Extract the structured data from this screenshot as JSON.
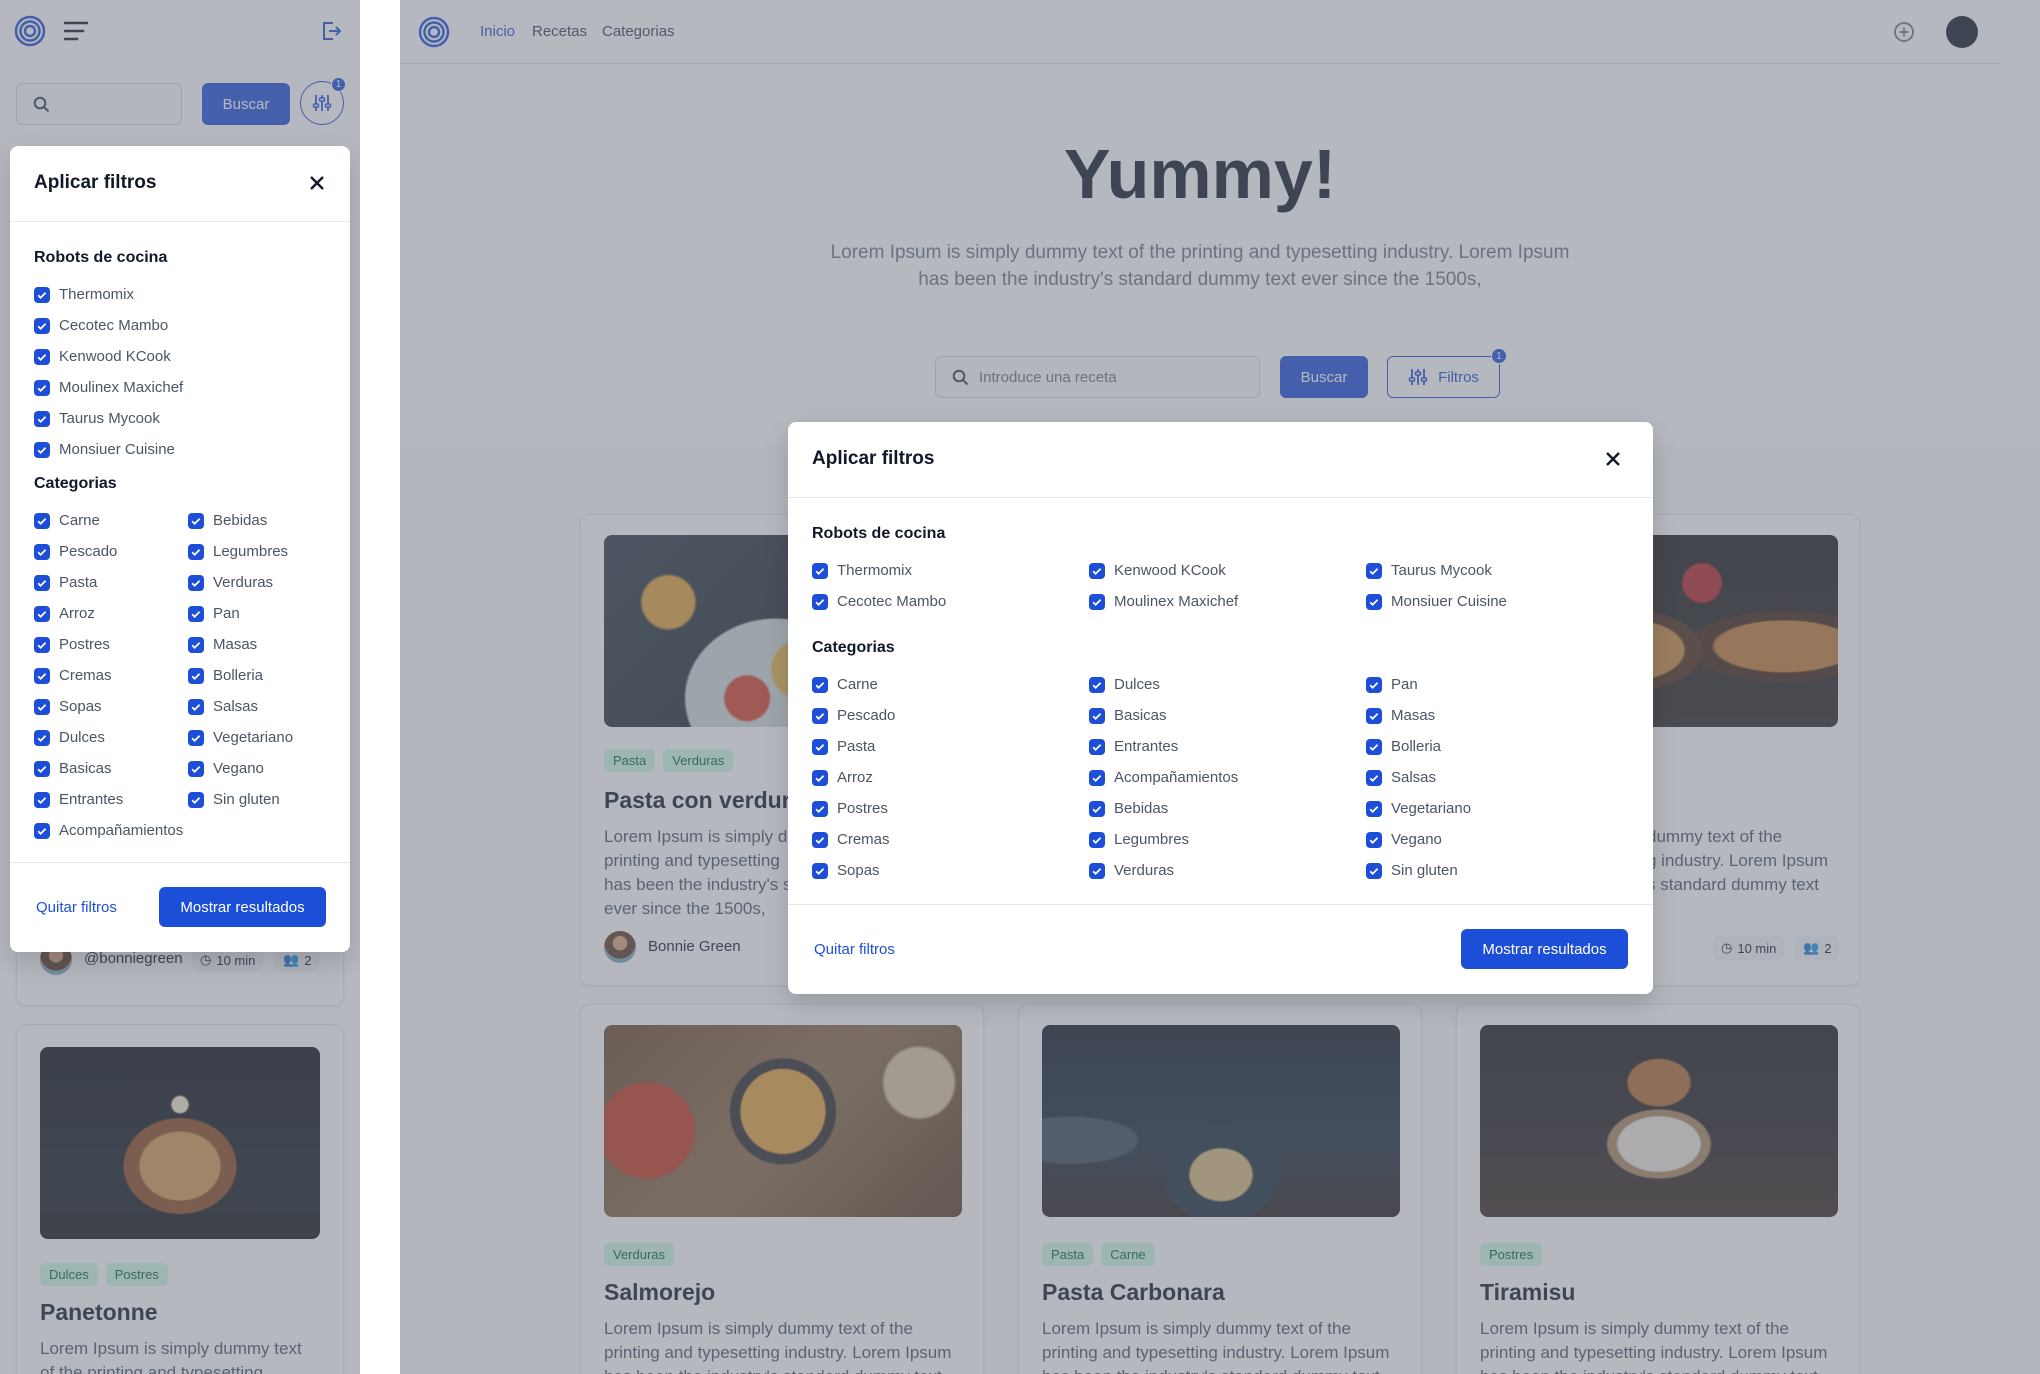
{
  "topnav": {
    "links": [
      "Inicio",
      "Recetas",
      "Categorias"
    ]
  },
  "hero": {
    "title": "Yummy!",
    "subtitle_line1": "Lorem Ipsum is simply dummy text of the printing and typesetting industry. Lorem Ipsum",
    "subtitle_line2": "has been the industry's standard dummy text ever since the 1500s,",
    "search_placeholder": "Introduce una receta",
    "search_button": "Buscar",
    "filters_button": "Filtros",
    "filters_badge": "1"
  },
  "sidebar": {
    "search_button": "Buscar",
    "filters_badge": "1"
  },
  "side_filter_panel": {
    "title": "Aplicar filtros",
    "robots_title": "Robots de cocina",
    "robots": [
      "Thermomix",
      "Cecotec Mambo",
      "Kenwood KCook",
      "Moulinex Maxichef",
      "Taurus Mycook",
      "Monsiuer Cuisine"
    ],
    "categories_title": "Categorias",
    "categories_col1": [
      "Carne",
      "Pescado",
      "Pasta",
      "Arroz",
      "Postres",
      "Cremas",
      "Sopas",
      "Dulces",
      "Basicas",
      "Entrantes",
      "Acompañamientos"
    ],
    "categories_col2": [
      "Bebidas",
      "Legumbres",
      "Verduras",
      "Pan",
      "Masas",
      "Bolleria",
      "Salsas",
      "Vegetariano",
      "Vegano",
      "Sin gluten"
    ],
    "clear_label": "Quitar filtros",
    "show_label": "Mostrar resultados"
  },
  "modal_filter_panel": {
    "title": "Aplicar filtros",
    "robots_title": "Robots de cocina",
    "robots_col1": [
      "Thermomix",
      "Cecotec Mambo"
    ],
    "robots_col2": [
      "Kenwood KCook",
      "Moulinex Maxichef"
    ],
    "robots_col3": [
      "Taurus Mycook",
      "Monsiuer Cuisine"
    ],
    "categories_title": "Categorias",
    "categories_col1": [
      "Carne",
      "Pescado",
      "Pasta",
      "Arroz",
      "Postres",
      "Cremas",
      "Sopas"
    ],
    "categories_col2": [
      "Dulces",
      "Basicas",
      "Entrantes",
      "Acompañamientos",
      "Bebidas",
      "Legumbres",
      "Verduras"
    ],
    "categories_col3": [
      "Pan",
      "Masas",
      "Bolleria",
      "Salsas",
      "Vegetariano",
      "Vegano",
      "Sin gluten"
    ],
    "clear_label": "Quitar filtros",
    "show_label": "Mostrar resultados"
  },
  "sidebar_card_top": {
    "author": "@bonniegreen",
    "time": "10 min",
    "servings": "2"
  },
  "sidebar_card": {
    "tags": [
      "Dulces",
      "Postres"
    ],
    "title": "Panetonne",
    "desc_line1": "Lorem Ipsum is simply dummy text",
    "desc_line2": "of the printing and typesetting"
  },
  "recipes_row1": {
    "left": {
      "tags": [
        "Pasta",
        "Verduras"
      ],
      "title": "Pasta con verdura",
      "desc_lines": [
        "Lorem Ipsum is simply du",
        "printing and typesetting",
        "has been the industry's s",
        "ever since the 1500s,"
      ],
      "author": "Bonnie Green"
    },
    "right": {
      "desc_lines": [
        "dummy text of the",
        "g industry. Lorem Ipsum",
        "s standard dummy text"
      ],
      "time": "10 min",
      "servings": "2"
    }
  },
  "recipes_row2": [
    {
      "tags": [
        "Verduras"
      ],
      "title": "Salmorejo",
      "desc_lines": [
        "Lorem Ipsum is simply dummy text of the",
        "printing and typesetting industry. Lorem Ipsum",
        "has been the industry's standard dummy text"
      ]
    },
    {
      "tags": [
        "Pasta",
        "Carne"
      ],
      "title": "Pasta Carbonara",
      "desc_lines": [
        "Lorem Ipsum is simply dummy text of the",
        "printing and typesetting industry. Lorem Ipsum",
        "has been the industry's standard dummy text"
      ]
    },
    {
      "tags": [
        "Postres"
      ],
      "title": "Tiramisu",
      "desc_lines": [
        "Lorem Ipsum is simply dummy text of the",
        "printing and typesetting industry. Lorem Ipsum",
        "has been the industry's standard dummy text"
      ]
    }
  ],
  "icons": [
    "spiral-logo-icon",
    "hamburger-menu-icon",
    "logout-icon",
    "search-icon",
    "sliders-icon",
    "close-icon",
    "check-icon",
    "plus-circle-icon",
    "avatar",
    "clock-icon",
    "users-icon"
  ],
  "colors": {
    "primary": "#1d4ed8",
    "overlay": "rgba(107,114,128,0.5)",
    "tag_bg": "#d1fae5",
    "tag_text": "#065f46"
  }
}
